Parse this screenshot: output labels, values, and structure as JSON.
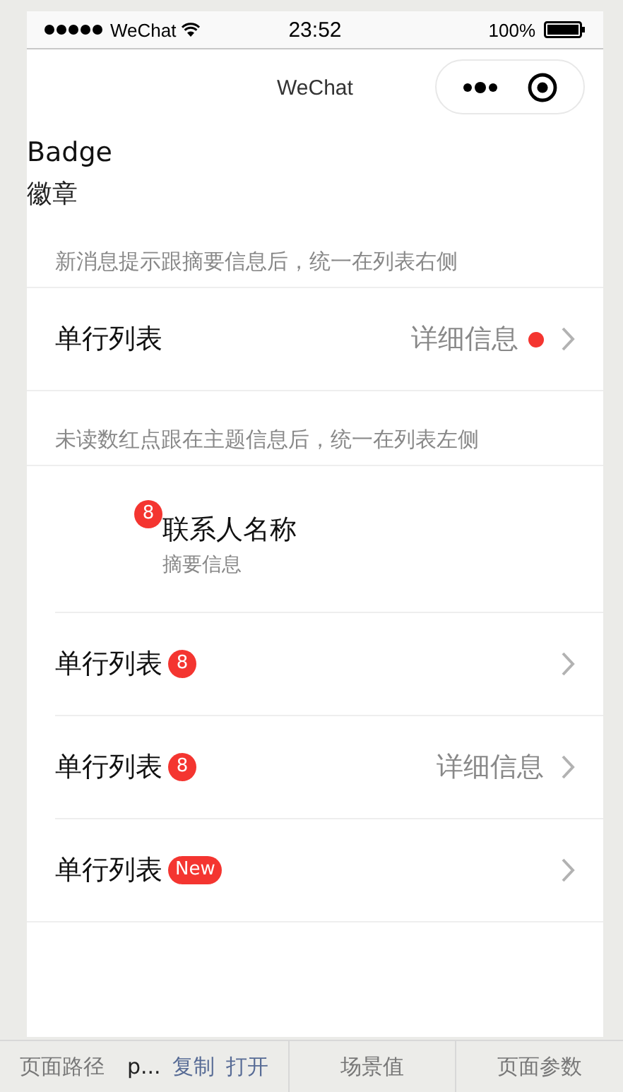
{
  "status_bar": {
    "carrier": "WeChat",
    "time": "23:52",
    "battery": "100%"
  },
  "nav": {
    "title": "WeChat"
  },
  "page": {
    "title": "Badge",
    "subtitle": "徽章"
  },
  "sections": [
    {
      "hint": "新消息提示跟摘要信息后，统一在列表右侧",
      "items": [
        {
          "kind": "row",
          "title": "单行列表",
          "detail": "详细信息",
          "dot": true
        }
      ]
    },
    {
      "hint": "未读数红点跟在主题信息后，统一在列表左侧",
      "items": [
        {
          "kind": "contact",
          "title": "联系人名称",
          "summary": "摘要信息",
          "badge": "8"
        },
        {
          "kind": "row",
          "title": "单行列表",
          "badge": "8",
          "dot": false
        },
        {
          "kind": "row",
          "title": "单行列表",
          "badge": "8",
          "detail": "详细信息",
          "dot": false
        },
        {
          "kind": "row",
          "title": "单行列表",
          "badge": "New",
          "dot": false
        }
      ]
    }
  ],
  "footer": [
    {
      "kind": "label",
      "text": "页面路径"
    },
    {
      "kind": "value",
      "text": "p..."
    },
    {
      "kind": "link",
      "text": "复制"
    },
    {
      "kind": "link",
      "text": "打开"
    },
    {
      "kind": "tab",
      "text": "场景值"
    },
    {
      "kind": "tab",
      "text": "页面参数"
    }
  ]
}
